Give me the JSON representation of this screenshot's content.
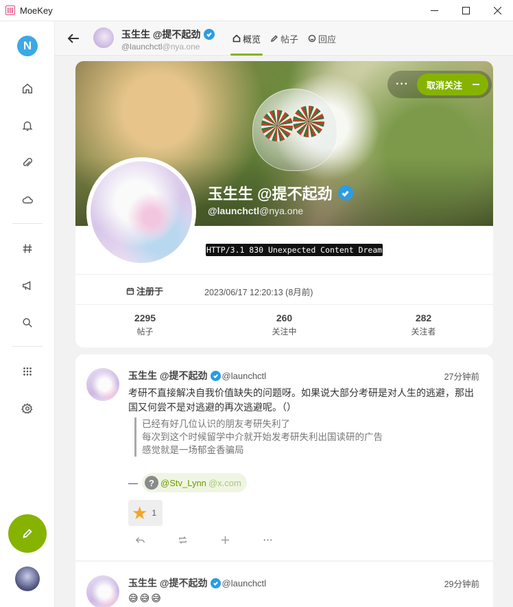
{
  "window": {
    "title": "MoeKey"
  },
  "sidebar": {
    "logo_letter": "N",
    "items": [
      "home-icon",
      "bell-icon",
      "paperclip-icon",
      "cloud-icon",
      "hash-icon",
      "megaphone-icon",
      "search-icon",
      "grid-icon",
      "gear-icon"
    ]
  },
  "header": {
    "name": "玉生生 @提不起劲",
    "handle": "@launchctl",
    "host": "@nya.one",
    "tabs": [
      {
        "label": "概览",
        "active": true
      },
      {
        "label": "帖子",
        "active": false
      },
      {
        "label": "回应",
        "active": false
      }
    ]
  },
  "profile": {
    "follow_more": "···",
    "unfollow_label": "取消关注",
    "name": "玉生生 @提不起劲",
    "handle": "@launchctl",
    "host": "@nya.one",
    "bio": "HTTP/3.1 830 Unexpected Content Dream",
    "field_label": "注册于",
    "field_value": "2023/06/17 12:20:13 (8月前)",
    "stats": [
      {
        "value": "2295",
        "label": "帖子"
      },
      {
        "value": "260",
        "label": "关注中"
      },
      {
        "value": "282",
        "label": "关注者"
      }
    ]
  },
  "notes": [
    {
      "name": "玉生生 @提不起劲",
      "handle": "@launchctl",
      "time": "27分钟前",
      "text": "考研不直接解决自我价值缺失的问题呀。如果说大部分考研是对人生的逃避，那出国又何尝不是对逃避的再次逃避呢。（）",
      "quote_lines": [
        "已经有好几位认识的朋友考研失利了",
        "每次到这个时候留学中介就开始发考研失利出国读研的广告",
        "感觉就是一场郁金香骗局"
      ],
      "mention_dash": "—",
      "mention_icon": "?",
      "mention_user": "@Stv_Lynn",
      "mention_host": "@x.com",
      "reaction_emoji": "★",
      "reaction_count": "1"
    },
    {
      "name": "玉生生 @提不起劲",
      "handle": "@launchctl",
      "time": "29分钟前",
      "text": "😅😅😅"
    }
  ],
  "colors": {
    "accent": "#86b300",
    "verified": "#2a9de3"
  }
}
